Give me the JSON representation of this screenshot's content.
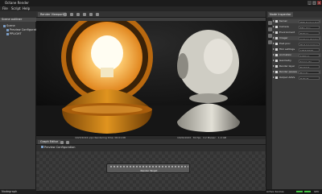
{
  "app": {
    "title": "Octane Render"
  },
  "window_controls": [
    "_",
    "□",
    "×"
  ],
  "menu": [
    "File",
    "Script",
    "Help"
  ],
  "left_panel": {
    "header": "Scene outliner",
    "items": [
      "Scene",
      "Preview Configuration",
      "PPLIGHT"
    ],
    "footer": "Nodegraph"
  },
  "render_viewport": {
    "tab": "Render Viewport",
    "status_left": "1023/1024 s/px   Rendering time: 00:01:08",
    "status_right": "1024x1024 · 84 fps · 4.2 Ms/sec · 1.4 GB"
  },
  "graph_editor": {
    "tab": "Graph Editor",
    "sub_item": "Preview Configuration",
    "node_label": "Render Target"
  },
  "right_panel": {
    "tab": "Node Inspector",
    "rows": [
      {
        "label": "Kernel",
        "value": "Path tracing kernel"
      },
      {
        "label": "Camera",
        "value": "Thin lens"
      },
      {
        "label": "Environment",
        "value": "Texture"
      },
      {
        "label": "Imager",
        "value": "Camera imager"
      },
      {
        "label": "Post proc",
        "value": "Post processing"
      },
      {
        "label": "Film settings",
        "value": "1024x1024"
      },
      {
        "label": "Animation",
        "value": "Settings"
      },
      {
        "label": "Geometry",
        "value": "Scene.obj"
      },
      {
        "label": "Render layer",
        "value": "Enabled"
      },
      {
        "label": "Render passes",
        "value": "Beauty"
      },
      {
        "label": "Output AOVs",
        "value": "Default"
      }
    ],
    "status": {
      "left": "Active devices",
      "right": "GPU"
    }
  },
  "colors": {
    "accent": "#43c043",
    "lamp_orange": "#e0841c",
    "lamp_white": "#d8d6cc"
  }
}
